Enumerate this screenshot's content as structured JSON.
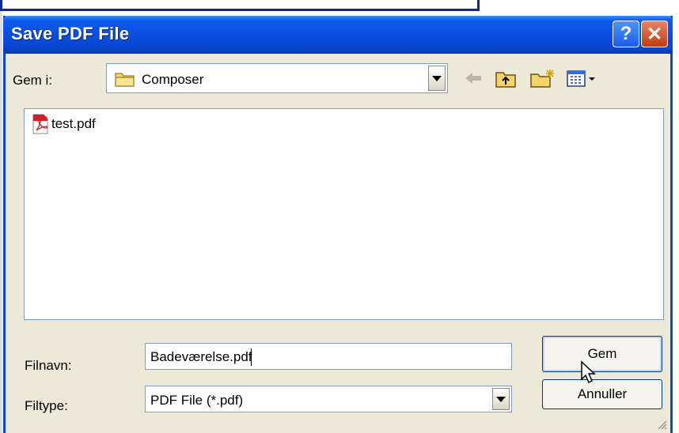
{
  "dialog": {
    "title": "Save PDF File",
    "help_label": "?",
    "close_label": "✕"
  },
  "lookin": {
    "label": "Gem i:",
    "value": "Composer"
  },
  "files": [
    {
      "name": "test.pdf"
    }
  ],
  "filename": {
    "label": "Filnavn:",
    "value": "Badeværelse.pdf"
  },
  "filetype": {
    "label": "Filtype:",
    "value": "PDF File (*.pdf)"
  },
  "buttons": {
    "save": "Gem",
    "cancel": "Annuller"
  },
  "colors": {
    "titlebar": "#0a4ee0",
    "dialog_bg": "#ece9d8"
  }
}
